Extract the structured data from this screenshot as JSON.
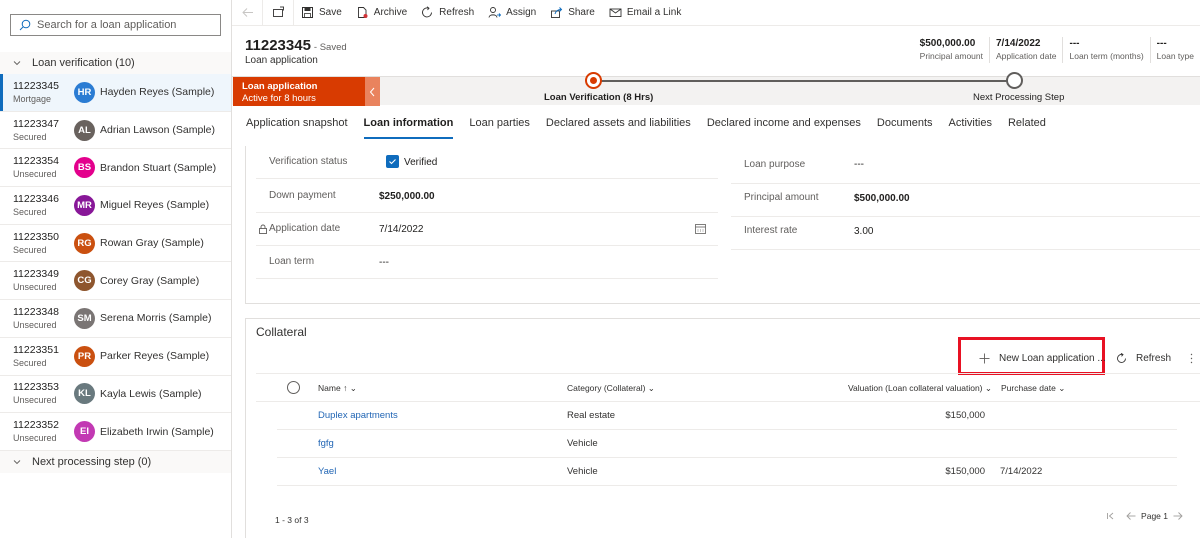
{
  "sidebar": {
    "search_placeholder": "Search for a loan application",
    "groups": [
      {
        "label": "Loan verification (10)"
      },
      {
        "label": "Next processing step (0)"
      }
    ],
    "items": [
      {
        "number": "11223345",
        "type": "Mortgage",
        "initials": "HR",
        "name": "Hayden Reyes (Sample)",
        "color": "#2b7cd3",
        "selected": true
      },
      {
        "number": "11223347",
        "type": "Secured",
        "initials": "AL",
        "name": "Adrian Lawson (Sample)",
        "color": "#69625e"
      },
      {
        "number": "11223354",
        "type": "Unsecured",
        "initials": "BS",
        "name": "Brandon Stuart (Sample)",
        "color": "#e3008c"
      },
      {
        "number": "11223346",
        "type": "Secured",
        "initials": "MR",
        "name": "Miguel Reyes (Sample)",
        "color": "#881798"
      },
      {
        "number": "11223350",
        "type": "Secured",
        "initials": "RG",
        "name": "Rowan Gray (Sample)",
        "color": "#ca5010"
      },
      {
        "number": "11223349",
        "type": "Unsecured",
        "initials": "CG",
        "name": "Corey Gray (Sample)",
        "color": "#8e562e"
      },
      {
        "number": "11223348",
        "type": "Unsecured",
        "initials": "SM",
        "name": "Serena Morris (Sample)",
        "color": "#7a7574"
      },
      {
        "number": "11223351",
        "type": "Secured",
        "initials": "PR",
        "name": "Parker Reyes (Sample)",
        "color": "#ca5010"
      },
      {
        "number": "11223353",
        "type": "Unsecured",
        "initials": "KL",
        "name": "Kayla Lewis (Sample)",
        "color": "#69797e"
      },
      {
        "number": "11223352",
        "type": "Unsecured",
        "initials": "EI",
        "name": "Elizabeth Irwin (Sample)",
        "color": "#c239b3"
      }
    ]
  },
  "toolbar": {
    "save": "Save",
    "archive": "Archive",
    "refresh": "Refresh",
    "assign": "Assign",
    "share": "Share",
    "email_link": "Email a Link"
  },
  "record": {
    "title": "11223345",
    "saved_status": "- Saved",
    "entity": "Loan application",
    "header_fields": [
      {
        "value": "$500,000.00",
        "label": "Principal amount"
      },
      {
        "value": "7/14/2022",
        "label": "Application date"
      },
      {
        "value": "---",
        "label": "Loan term (months)"
      },
      {
        "value": "---",
        "label": "Loan type"
      }
    ]
  },
  "process": {
    "active_stage_title": "Loan application",
    "active_stage_sub": "Active for 8 hours",
    "current_label": "Loan Verification  (8 Hrs)",
    "next_label": "Next Processing Step",
    "accent": "#d83b01"
  },
  "tabs": [
    {
      "label": "Application snapshot"
    },
    {
      "label": "Loan information",
      "active": true
    },
    {
      "label": "Loan parties"
    },
    {
      "label": "Declared assets and liabilities"
    },
    {
      "label": "Declared income and expenses"
    },
    {
      "label": "Documents"
    },
    {
      "label": "Activities"
    },
    {
      "label": "Related"
    }
  ],
  "form": {
    "left": [
      {
        "label": "Verification status",
        "value": "Verified"
      },
      {
        "label": "Down payment",
        "value": "$250,000.00"
      },
      {
        "label": "Application date",
        "value": "7/14/2022"
      },
      {
        "label": "Loan term",
        "value": "---"
      }
    ],
    "right": [
      {
        "label": "Loan purpose",
        "value": "---"
      },
      {
        "label": "Principal amount",
        "value": "$500,000.00"
      },
      {
        "label": "Interest rate",
        "value": "3.00"
      }
    ]
  },
  "collateral": {
    "title": "Collateral",
    "new_button": "New Loan application ...",
    "refresh_button": "Refresh",
    "columns": {
      "name": "Name",
      "category": "Category (Collateral)",
      "valuation": "Valuation (Loan collateral valuation)",
      "purchase_date": "Purchase date"
    },
    "rows": [
      {
        "name": "Duplex apartments",
        "category": "Real estate",
        "valuation": "$150,000",
        "purchase_date": ""
      },
      {
        "name": "fgfg",
        "category": "Vehicle",
        "valuation": "",
        "purchase_date": ""
      },
      {
        "name": "Yael",
        "category": "Vehicle",
        "valuation": "$150,000",
        "purchase_date": "7/14/2022"
      }
    ],
    "count_text": "1 - 3 of 3",
    "page_text": "Page 1"
  }
}
